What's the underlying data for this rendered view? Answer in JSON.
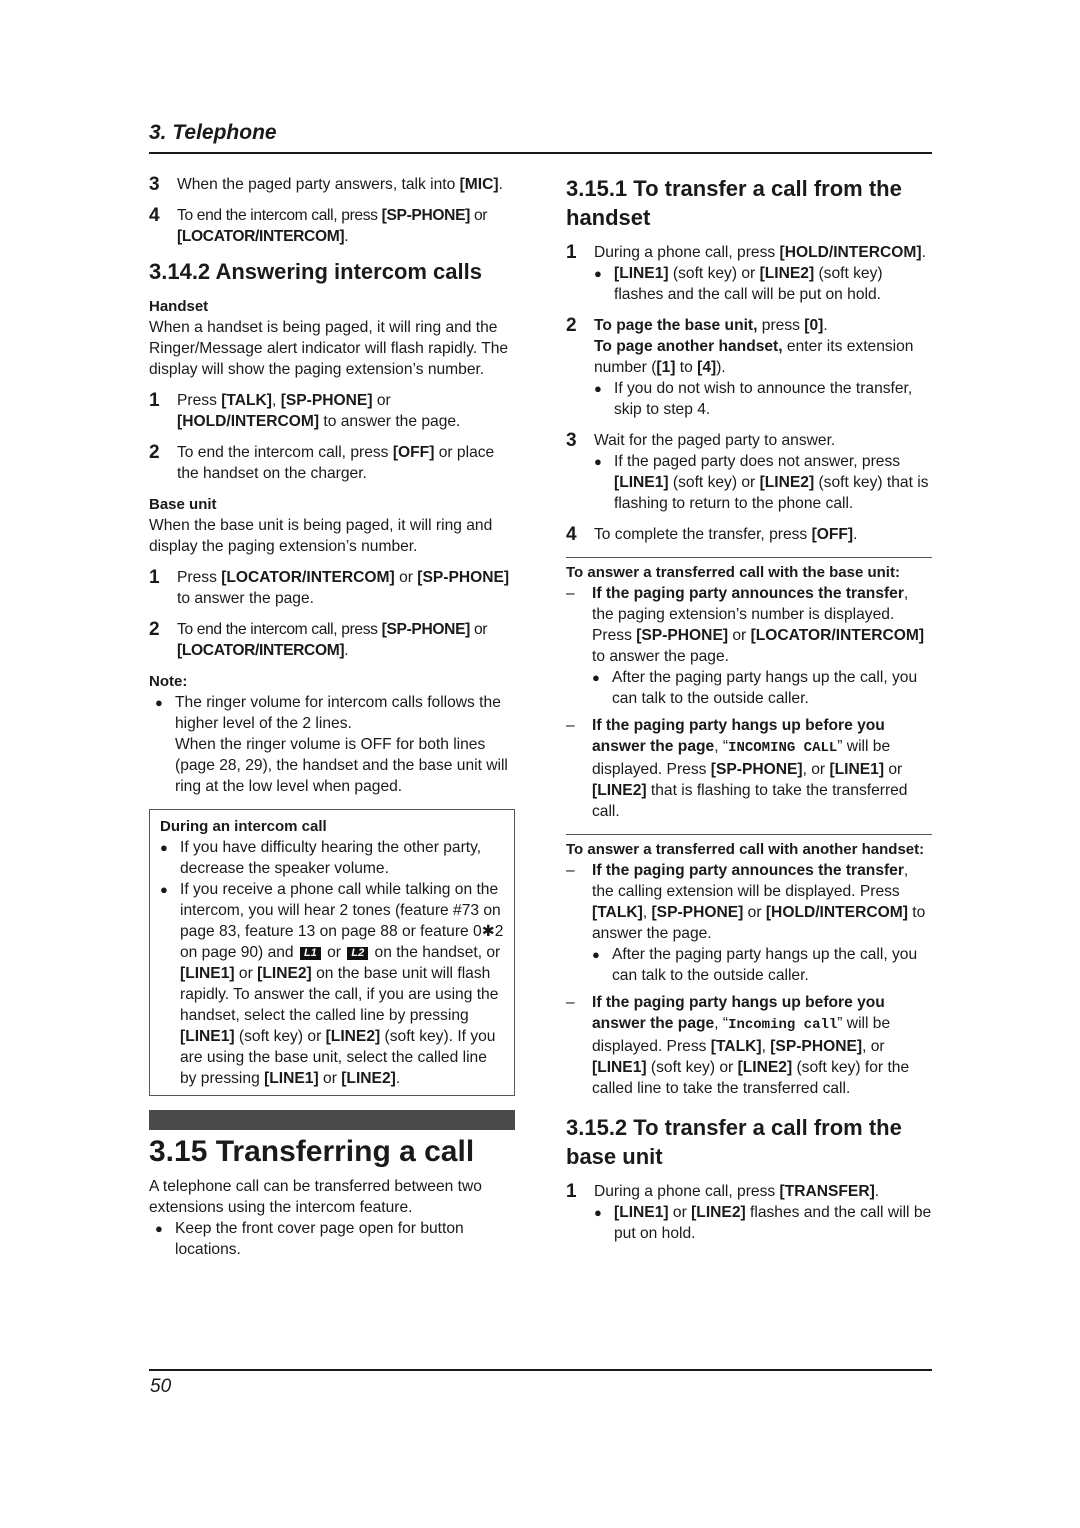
{
  "header": {
    "chapter": "3. Telephone"
  },
  "footer": {
    "page_number": "50"
  },
  "left": {
    "steps_top": [
      {
        "num": "3",
        "parts": [
          "When the paged party answers, talk into ",
          "[MIC]",
          "."
        ]
      },
      {
        "num": "4",
        "parts": [
          "To end the intercom call, press ",
          "[SP-PHONE]",
          " or ",
          "[LOCATOR/INTERCOM]",
          "."
        ]
      }
    ],
    "answering": {
      "title": "3.14.2 Answering intercom calls",
      "handset": {
        "label": "Handset",
        "text": "When a handset is being paged, it will ring and the Ringer/Message alert indicator will flash rapidly. The display will show the paging extension’s number.",
        "steps": [
          {
            "num": "1",
            "parts": [
              "Press ",
              "[TALK]",
              ", ",
              "[SP-PHONE]",
              " or ",
              "[HOLD/INTERCOM]",
              " to answer the page."
            ]
          },
          {
            "num": "2",
            "parts": [
              "To end the intercom call, press ",
              "[OFF]",
              " or place the handset on the charger."
            ]
          }
        ]
      },
      "base_unit": {
        "label": "Base unit",
        "text": "When the base unit is being paged, it will ring and display the paging extension’s number.",
        "steps": [
          {
            "num": "1",
            "parts": [
              "Press ",
              "[LOCATOR/INTERCOM]",
              " or ",
              "[SP-PHONE]",
              " to answer the page."
            ]
          },
          {
            "num": "2",
            "parts": [
              "To end the intercom call, press ",
              "[SP-PHONE]",
              " or ",
              "[LOCATOR/INTERCOM]",
              "."
            ]
          }
        ]
      },
      "note": {
        "label": "Note:",
        "bullet_1": "The ringer volume for intercom calls follows the higher level of the 2 lines.",
        "bullet_2": "When the ringer volume is OFF for both lines (page 28, 29), the handset and the base unit will ring at the low level when paged."
      },
      "box": {
        "title": "During an intercom call",
        "bullet_1": "If you have difficulty hearing the other party, decrease the speaker volume.",
        "bullet_2_a": "If you receive a phone call while talking on the intercom, you will hear 2 tones (feature #73 on page 83, feature 13 on page 88 or feature 0✱2 on page 90) and",
        "lcd_l1": "L1",
        "or": "or",
        "lcd_l2": "L2",
        "bullet_2_b": "on the handset, or",
        "line1": "[LINE1]",
        "line2": "[LINE2]",
        "bullet_2_c": "on the base unit will flash rapidly. To answer the call, if you are using the handset, select the called line by pressing",
        "soft_key": "(soft key)",
        "bullet_2_d": ". If you are using the base unit, select the called line by pressing",
        "end": "."
      }
    },
    "transferring": {
      "title": "3.15 Transferring a call",
      "text": "A telephone call can be transferred between two extensions using the intercom feature.",
      "bullet": "Keep the front cover page open for button locations."
    }
  },
  "right": {
    "from_handset": {
      "title": "3.15.1 To transfer a call from the handset",
      "step1": {
        "num": "1",
        "text": "During a phone call, press ",
        "key": "[HOLD/INTERCOM]",
        "end": ".",
        "bullet": {
          "k1": "[LINE1]",
          "t1": " (soft key) or ",
          "k2": "[LINE2]",
          "t2": " (soft key) flashes and the call will be put on hold."
        }
      },
      "step2": {
        "num": "2",
        "b1": "To page the base unit,",
        "t1": " press ",
        "k0": "[0]",
        "t2": ".",
        "b2": "To page another handset,",
        "t3": " enter its extension number (",
        "k1": "[1]",
        "t4": " to ",
        "k4": "[4]",
        "t5": ").",
        "bullet": "If you do not wish to announce the transfer, skip to step 4."
      },
      "step3": {
        "num": "3",
        "text": "Wait for the paged party to answer.",
        "bullet": {
          "t0": "If the paged party does not answer, press ",
          "k1": "[LINE1]",
          "t1": " (soft key) or ",
          "k2": "[LINE2]",
          "t2": " (soft key) that is flashing to return to the phone call."
        }
      },
      "step4": {
        "num": "4",
        "text": "To complete the transfer, press ",
        "key": "[OFF]",
        "end": "."
      }
    },
    "answer_base": {
      "title": "To answer a transferred call with the base unit:",
      "dash1": {
        "bold": "If the paging party announces the transfer",
        "t1": ", the paging extension’s number is displayed. Press ",
        "k1": "[SP-PHONE]",
        "t2": " or ",
        "k2": "[LOCATOR/INTERCOM]",
        "t3": " to answer the page.",
        "bullet": "After the paging party hangs up the call, you can talk to the outside caller."
      },
      "dash2": {
        "bold": "If the paging party hangs up before you answer the page",
        "t1": ", “",
        "display": "INCOMING CALL",
        "t2": "” will be displayed. Press ",
        "k1": "[SP-PHONE]",
        "t3": ", or ",
        "k2": "[LINE1]",
        "t4": " or ",
        "k3": "[LINE2]",
        "t5": " that is flashing to take the transferred call."
      }
    },
    "answer_handset": {
      "title": "To answer a transferred call with another handset:",
      "dash1": {
        "bold": "If the paging party announces the transfer",
        "t1": ", the calling extension will be displayed. Press ",
        "k1": "[TALK]",
        "t2": ", ",
        "k2": "[SP-PHONE]",
        "t3": " or ",
        "k3": "[HOLD/INTERCOM]",
        "t4": " to answer the page.",
        "bullet": "After the paging party hangs up the call, you can talk to the outside caller."
      },
      "dash2": {
        "bold": "If the paging party hangs up before you answer the page",
        "t1": ", “",
        "display": "Incoming call",
        "t2": "” will be displayed. Press ",
        "k1": "[TALK]",
        "t3": ", ",
        "k2": "[SP-PHONE]",
        "t4": ", or ",
        "k3": "[LINE1]",
        "t5": " (soft key) or ",
        "k4": "[LINE2]",
        "t6": " (soft key) for the called line to take the transferred call."
      }
    },
    "from_base": {
      "title": "3.15.2 To transfer a call from the base unit",
      "step1": {
        "num": "1",
        "text": "During a phone call, press ",
        "key": "[TRANSFER]",
        "end": ".",
        "bullet": {
          "k1": "[LINE1]",
          "t1": " or ",
          "k2": "[LINE2]",
          "t2": " flashes and the call will be put on hold."
        }
      }
    }
  }
}
